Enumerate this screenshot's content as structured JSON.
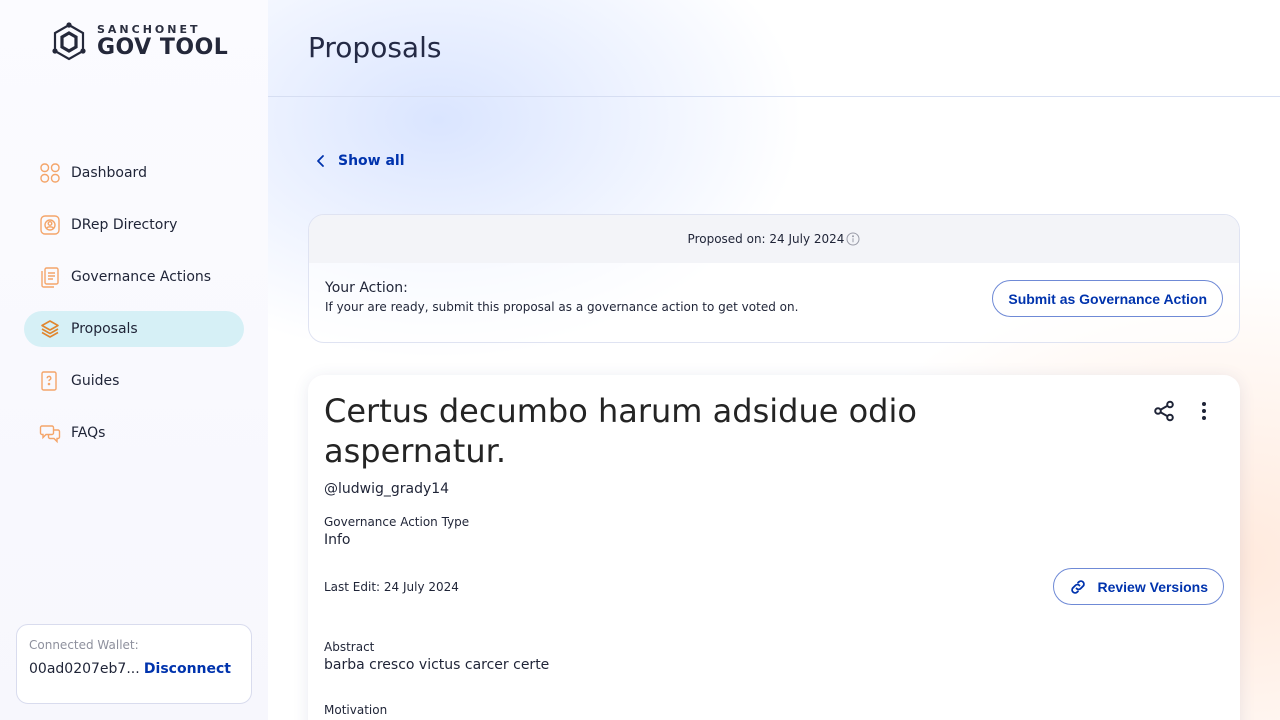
{
  "brand": {
    "small": "SANCHONET",
    "big": "GOV TOOL"
  },
  "sidebar": {
    "items": [
      {
        "label": "Dashboard",
        "icon": "dashboard-icon"
      },
      {
        "label": "DRep Directory",
        "icon": "drep-directory-icon"
      },
      {
        "label": "Governance Actions",
        "icon": "governance-actions-icon"
      },
      {
        "label": "Proposals",
        "icon": "proposals-icon",
        "active": true
      },
      {
        "label": "Guides",
        "icon": "guides-icon"
      },
      {
        "label": "FAQs",
        "icon": "faqs-icon"
      }
    ],
    "wallet": {
      "label": "Connected Wallet:",
      "address": "00ad0207eb7...",
      "disconnect": "Disconnect"
    }
  },
  "header": {
    "title": "Proposals"
  },
  "nav": {
    "show_all": "Show all"
  },
  "action_box": {
    "proposed_on": "Proposed on: 24 July 2024",
    "your_action": "Your Action:",
    "description": "If your are ready, submit this proposal as a governance action to get voted on.",
    "submit_label": "Submit as Governance Action"
  },
  "proposal": {
    "title": "Certus decumbo harum adsidue odio aspernatur.",
    "author": "@ludwig_grady14",
    "type_label": "Governance Action Type",
    "type_value": "Info",
    "last_edit": "Last Edit: 24 July 2024",
    "review_label": "Review Versions",
    "abstract_label": "Abstract",
    "abstract_value": "barba cresco victus carcer certe",
    "motivation_label": "Motivation"
  },
  "colors": {
    "accent": "#0033ad",
    "active_nav_bg": "#d6f0f6",
    "icon_orange": "#f4a56a"
  }
}
